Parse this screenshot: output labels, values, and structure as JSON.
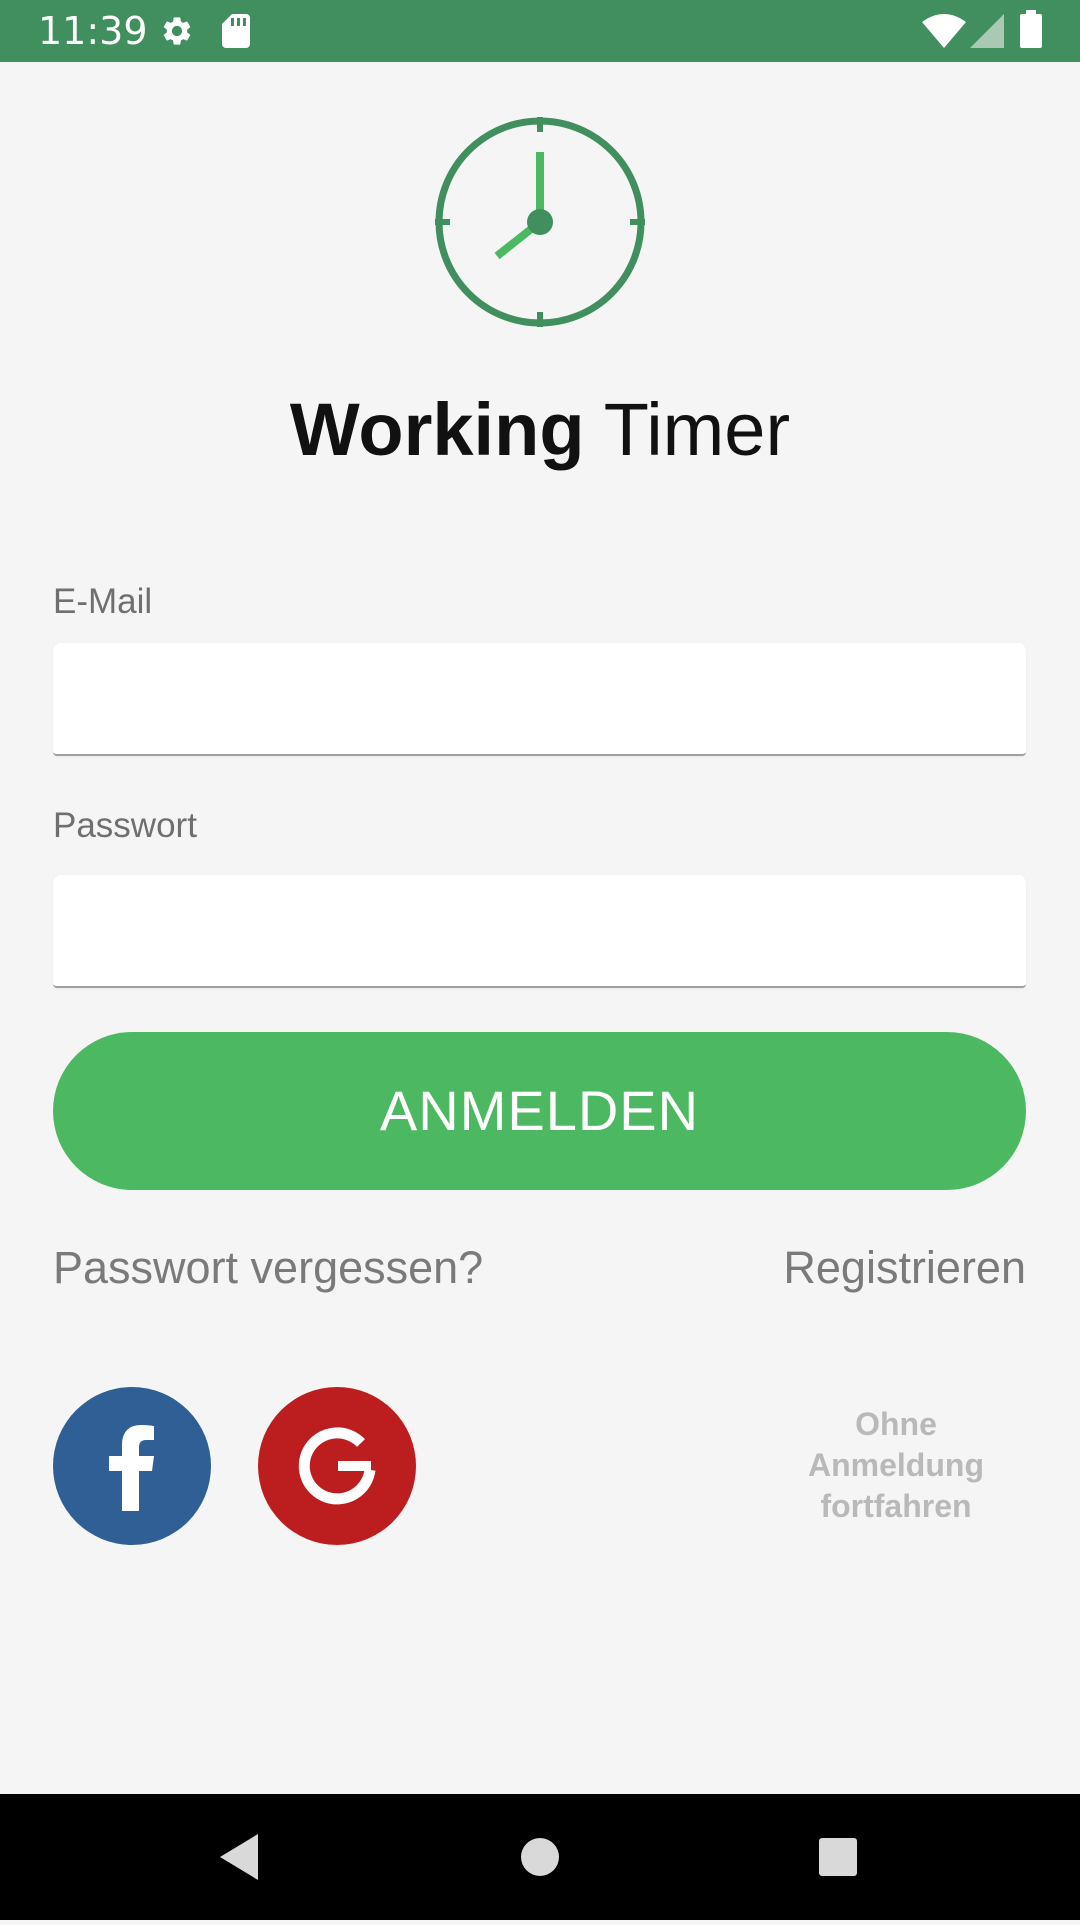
{
  "status_bar": {
    "time": "11:39",
    "background": "#418e5f",
    "icons": [
      "settings-icon",
      "sd-card-icon",
      "wifi-icon",
      "cell-signal-icon",
      "battery-icon"
    ]
  },
  "app": {
    "title_bold": "Working",
    "title_regular": "Timer",
    "logo_icon": "clock-icon"
  },
  "form": {
    "email_label": "E-Mail",
    "email_value": "",
    "password_label": "Passwort",
    "password_value": ""
  },
  "actions": {
    "login_label": "ANMELDEN",
    "forgot_password_label": "Passwort vergessen?",
    "register_label": "Registrieren",
    "guest_label_line1": "Ohne",
    "guest_label_line2": "Anmeldung",
    "guest_label_line3": "fortfahren"
  },
  "social": {
    "facebook_icon": "facebook-icon",
    "google_icon": "google-icon"
  },
  "colors": {
    "accent": "#4cb962",
    "primary_dark": "#418e5f",
    "facebook": "#2f5f94",
    "google": "#bc1e20"
  },
  "nav_bar": {
    "icons": [
      "back-icon",
      "home-icon",
      "recents-icon"
    ]
  }
}
